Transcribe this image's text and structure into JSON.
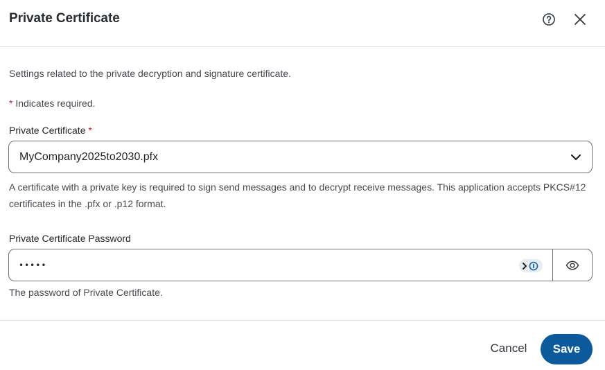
{
  "dialog": {
    "title": "Private Certificate",
    "help_icon": "help-circle-icon",
    "close_icon": "close-icon"
  },
  "description": "Settings related to the private decryption and signature certificate.",
  "required_note": {
    "star": "*",
    "text": " Indicates required."
  },
  "certificate_field": {
    "label": "Private Certificate",
    "required_star": " *",
    "selected_value": "MyCompany2025to2030.pfx",
    "dropdown_icon": "chevron-down-icon",
    "help_text": "A certificate with a private key is required to sign send messages and to decrypt receive messages. This application accepts PKCS#12 certificates in the .pfx or .p12 format."
  },
  "password_field": {
    "label": "Private Certificate Password",
    "value": "•••••",
    "password_manager_icon": "password-manager-icon",
    "reveal_icon": "eye-icon",
    "help_text": "The password of Private Certificate."
  },
  "footer": {
    "cancel_label": "Cancel",
    "save_label": "Save"
  },
  "colors": {
    "primary": "#0a5a9c",
    "required": "#c8252c",
    "border": "#6b7178",
    "divider": "#dcdfe3"
  }
}
